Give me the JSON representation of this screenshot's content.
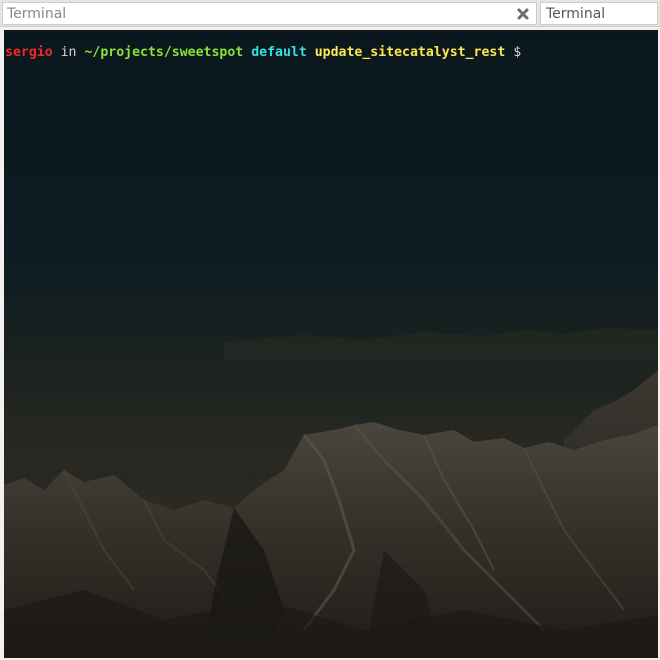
{
  "tabs": [
    {
      "title": "Terminal",
      "active": true,
      "close_icon": "close-icon"
    },
    {
      "title": "Terminal",
      "active": false
    }
  ],
  "terminal": {
    "prompt": {
      "user": "sergio",
      "in": "in",
      "path": "~/projects/sweetspot",
      "env": "default",
      "branch": "update_sitecatalyst_rest",
      "symbol": "$"
    },
    "colors": {
      "user": "#ef2929",
      "path": "#8ae234",
      "env": "#34e2e2",
      "branch": "#fce94f",
      "text": "#d3d7cf"
    },
    "background_image": "mountain-range-dusk"
  }
}
